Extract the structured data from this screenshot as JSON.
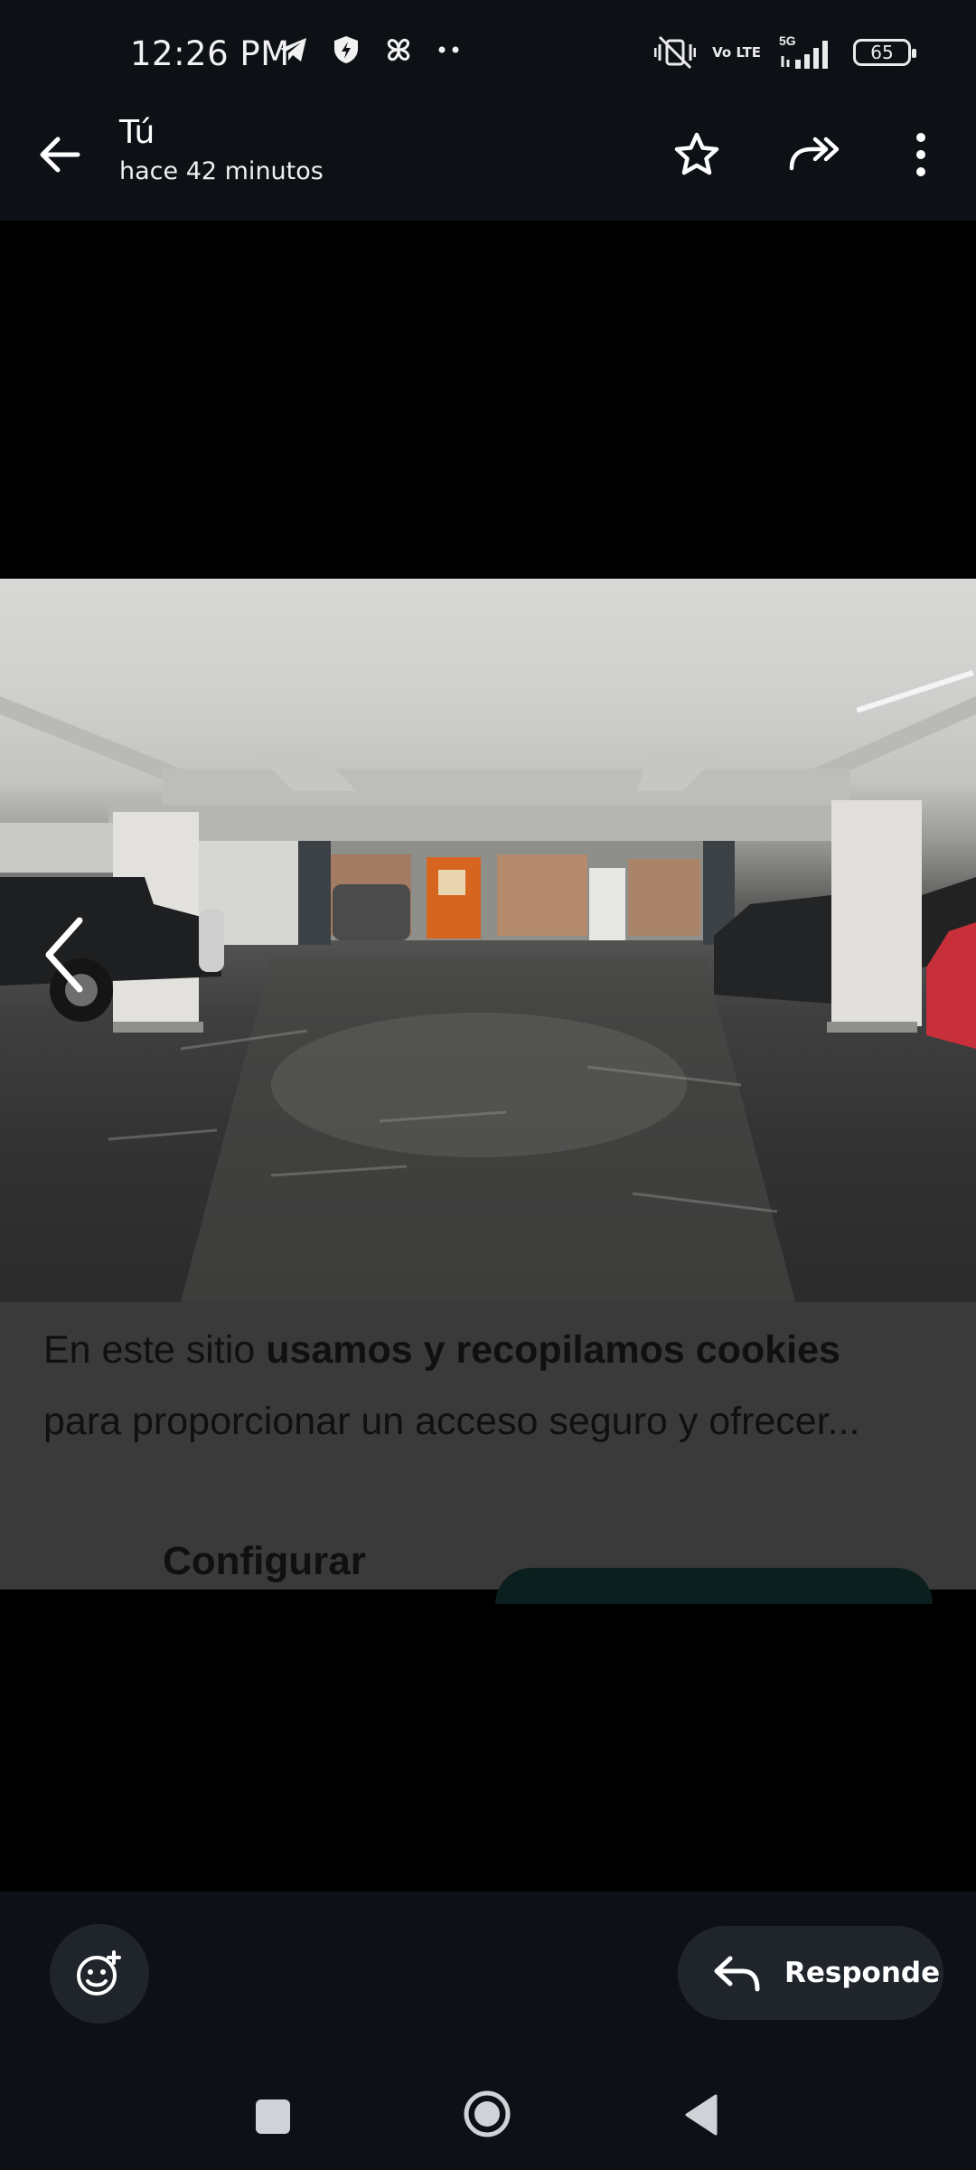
{
  "status_bar": {
    "time": "12:26 PM",
    "battery": "65",
    "network": "5G",
    "volte": "Vo LTE"
  },
  "header": {
    "title": "Tú",
    "subtitle": "hace 42 minutos"
  },
  "cookie_banner": {
    "text_prefix": "En este sitio ",
    "text_bold": "usamos y recopilamos cookies",
    "text_suffix": "para proporcionar un acceso seguro y ofrecer...",
    "configure_label": "Configurar"
  },
  "footer": {
    "reply_label": "Responde"
  },
  "icons": {
    "back": "arrow-left-icon",
    "star": "star-icon",
    "forward": "forward-icon",
    "menu": "more-vertical-icon",
    "previous": "chevron-left-icon",
    "emoji": "add-reaction-icon",
    "reply": "reply-icon"
  }
}
